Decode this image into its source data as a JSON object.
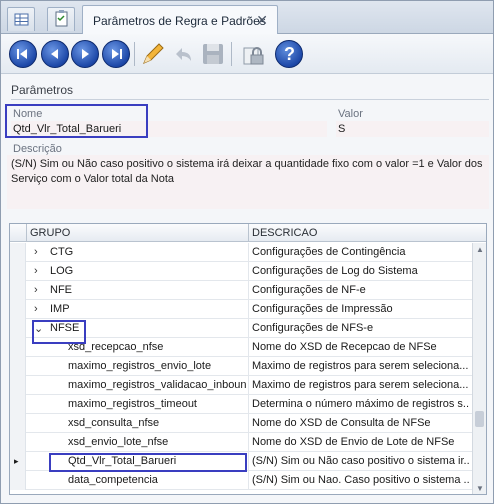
{
  "tabs": {
    "icon_tab_1": "grid-icon",
    "icon_tab_2": "checklist-icon",
    "main_label": "Parâmetros de Regra e Padrões",
    "close_glyph": "✕"
  },
  "toolbar": {
    "first": "first-record-icon",
    "prev": "previous-record-icon",
    "next": "next-record-icon",
    "last": "last-record-icon",
    "edit": "edit-pencil-icon",
    "undo": "undo-icon",
    "save": "save-disk-icon",
    "lock": "lock-icon",
    "help": "help-icon",
    "help_glyph": "?"
  },
  "section": {
    "title": "Parâmetros"
  },
  "form": {
    "nome_label": "Nome",
    "nome_value": "Qtd_Vlr_Total_Barueri",
    "valor_label": "Valor",
    "valor_value": "S",
    "descricao_label": "Descrição",
    "descricao_value": "(S/N) Sim ou Não caso positivo o sistema irá deixar a quantidade fixo com o valor =1 e Valor dos Serviço com o Valor total da Nota"
  },
  "grid": {
    "col_grupo": "GRUPO",
    "col_descricao": "DESCRICAO",
    "rows": [
      {
        "expander": "›",
        "grupo": "CTG",
        "descricao": "Configurações de Contingência"
      },
      {
        "expander": "›",
        "grupo": "LOG",
        "descricao": "Configurações de Log do Sistema"
      },
      {
        "expander": "›",
        "grupo": "NFE",
        "descricao": "Configurações de NF-e"
      },
      {
        "expander": "›",
        "grupo": "IMP",
        "descricao": "Configurações de Impressão"
      },
      {
        "expander": "⌄",
        "grupo": "NFSE",
        "descricao": "Configurações de NFS-e"
      },
      {
        "grupo": "xsd_recepcao_nfse",
        "descricao": "Nome do XSD de Recepcao de NFSe"
      },
      {
        "grupo": "maximo_registros_envio_lote",
        "descricao": "Maximo de registros para serem seleciona..."
      },
      {
        "grupo": "maximo_registros_validacao_inbound",
        "descricao": "Maximo de registros para serem seleciona..."
      },
      {
        "grupo": "maximo_registros_timeout",
        "descricao": "Determina o número máximo de registros s..."
      },
      {
        "grupo": "xsd_consulta_nfse",
        "descricao": "Nome do XSD de Consulta de NFSe"
      },
      {
        "grupo": "xsd_envio_lote_nfse",
        "descricao": "Nome do XSD de Envio de Lote de NFSe"
      },
      {
        "grupo": "Qtd_Vlr_Total_Barueri",
        "descricao": "(S/N) Sim ou Não caso positivo o sistema ir..."
      },
      {
        "grupo": "data_competencia",
        "descricao": "(S/N) Sim ou Nao. Caso positivo o sistema ..."
      }
    ],
    "current_row_marker": "▸"
  },
  "colors": {
    "highlight_border": "#3a3ec0",
    "nav_button": "#1d48a8",
    "help_button": "#1d48a8"
  }
}
